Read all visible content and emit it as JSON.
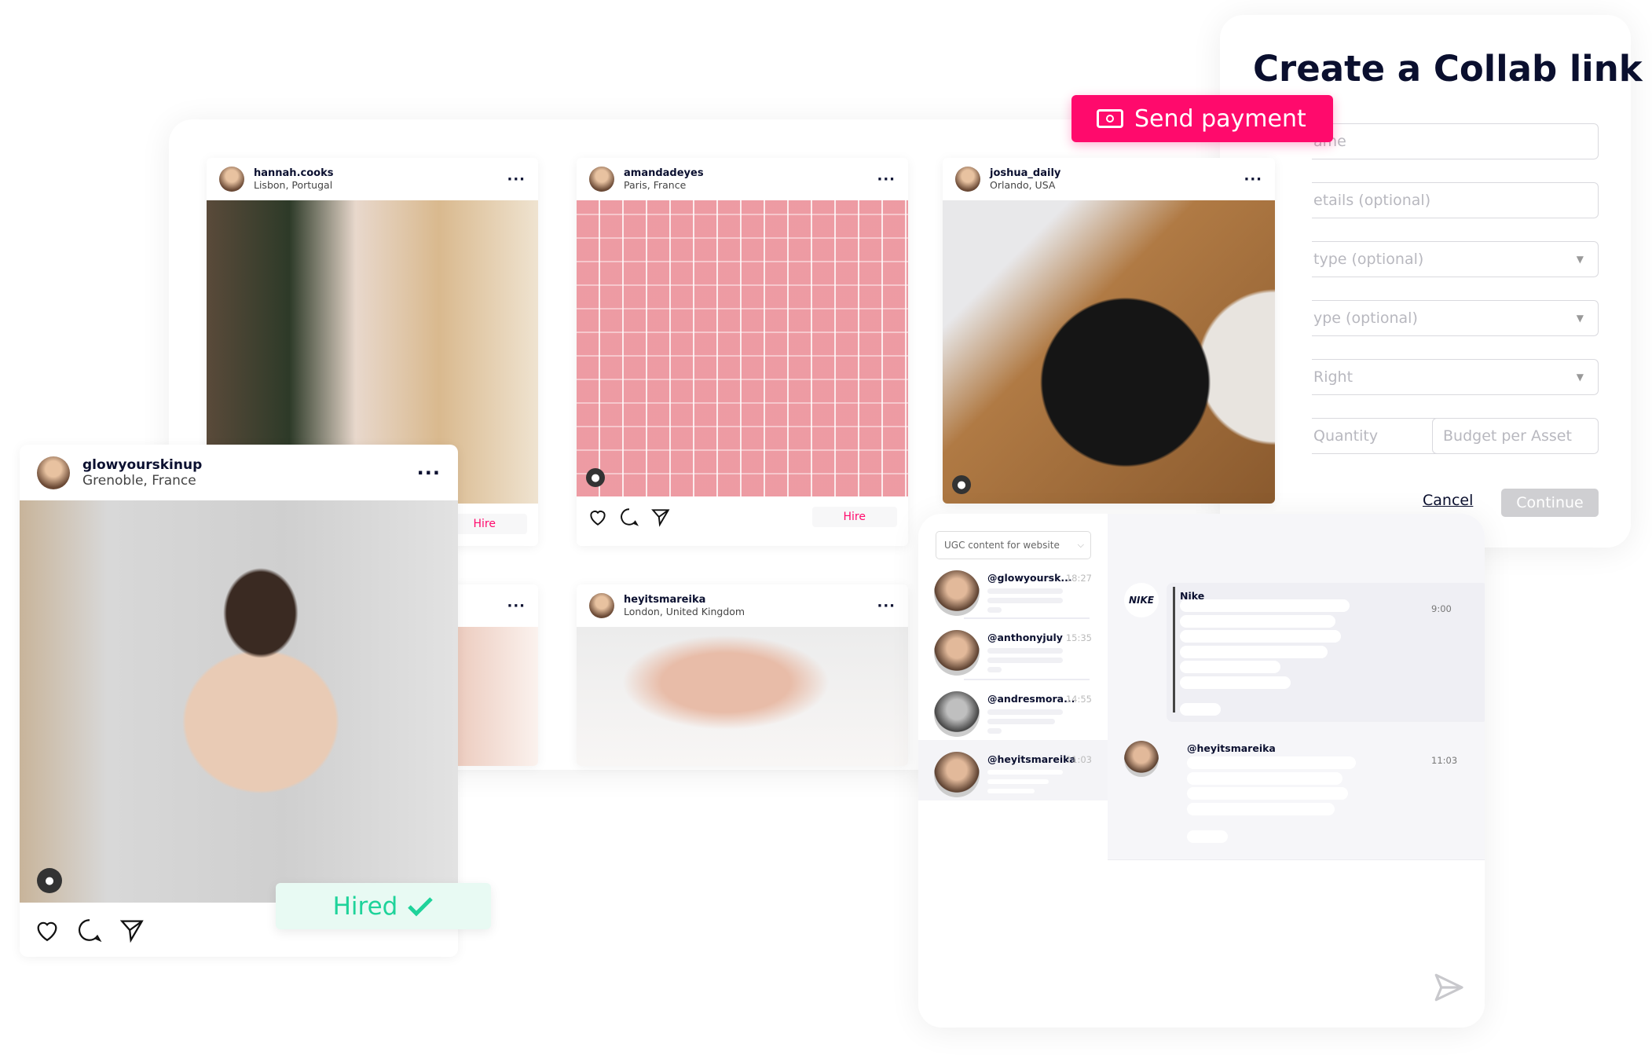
{
  "collab": {
    "title": "Create a Collab link",
    "fields": [
      "ame",
      "etails (optional)",
      "type (optional)",
      "ype (optional)",
      "Right",
      "Quantity",
      "Budget per Asset"
    ],
    "cancel": "Cancel",
    "continue": "Continue"
  },
  "send_payment": {
    "label": "Send payment",
    "icon": "money-icon",
    "color": "#ff0a6c"
  },
  "posts": [
    {
      "user": "hannah.cooks",
      "location": "Lisbon, Portugal",
      "hire": "Hire"
    },
    {
      "user": "amandadeyes",
      "location": "Paris, France",
      "hire": "Hire"
    },
    {
      "user": "joshua_daily",
      "location": "Orlando, USA"
    },
    {
      "user": "heyitsmareika",
      "location": "London, United Kingdom"
    }
  ],
  "featured": {
    "user": "glowyourskinup",
    "location": "Grenoble, France",
    "badge": "Hired",
    "badge_color": "#1ed39a"
  },
  "chat": {
    "campaign": "UGC content for website",
    "conversations": [
      {
        "handle": "@glowyoursk...",
        "time": "18:27"
      },
      {
        "handle": "@anthonyjuly",
        "time": "15:35"
      },
      {
        "handle": "@andresmora...",
        "time": "14:55"
      },
      {
        "handle": "@heyitsmareika",
        "time": "11:03"
      }
    ],
    "messages": [
      {
        "sender": "Nike",
        "time": "9:00"
      },
      {
        "sender": "@heyitsmareika",
        "time": "11:03"
      }
    ]
  }
}
